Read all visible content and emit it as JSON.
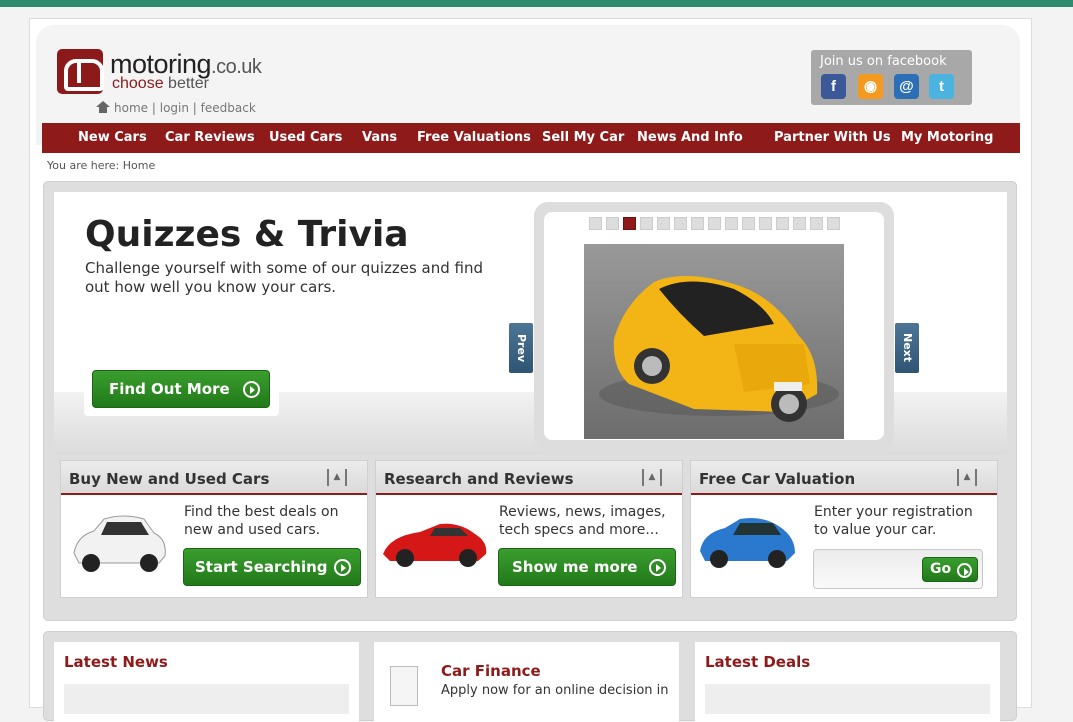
{
  "header": {
    "logo_main": "motoring",
    "logo_domain": ".co.uk",
    "logo_tag_1": "choose",
    "logo_tag_2": "better",
    "links": [
      "home",
      "login",
      "feedback"
    ],
    "link_sep": "|",
    "facebook_title": "Join us on facebook",
    "social_icons": [
      "facebook-icon",
      "rss-icon",
      "email-icon",
      "twitter-icon"
    ]
  },
  "nav": [
    "New Cars",
    "Car Reviews",
    "Used Cars",
    "Vans",
    "Free Valuations",
    "Sell My Car",
    "News And Info",
    "Partner With Us",
    "My Motoring"
  ],
  "breadcrumb": "You are here: Home",
  "hero": {
    "title": "Quizzes & Trivia",
    "text": "Challenge yourself with some of our quizzes and find out how well you know your cars.",
    "button": "Find Out More",
    "prev": "Prev",
    "next": "Next",
    "active_slide": 3,
    "slide_count": 15
  },
  "panels": [
    {
      "title": "Buy New and Used Cars",
      "text": "Find the best deals on new and used cars.",
      "button": "Start Searching",
      "collapse": "▲"
    },
    {
      "title": "Research and Reviews",
      "text": "Reviews, news, images, tech specs and more...",
      "button": "Show me more",
      "collapse": "▲"
    },
    {
      "title": "Free Car Valuation",
      "text": "Enter your registration to value your car.",
      "button": "Go",
      "collapse": "▲"
    }
  ],
  "lower": {
    "news_title": "Latest News",
    "finance_title": "Car Finance",
    "finance_text": "Apply now for an online decision in",
    "deals_title": "Latest Deals"
  },
  "colors": {
    "brand": "#8e1a1a",
    "green": "#2c8a22",
    "nav": "#8e1a1a"
  }
}
